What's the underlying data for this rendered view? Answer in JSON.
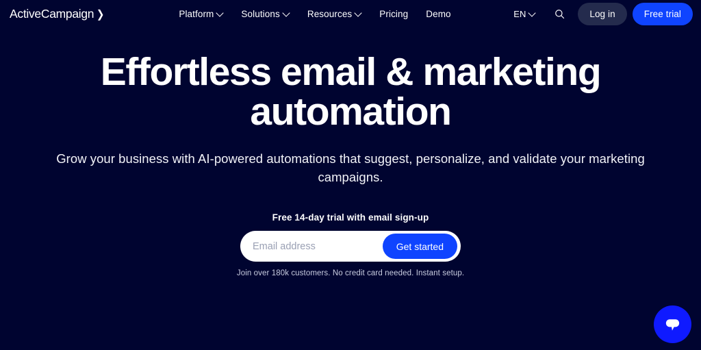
{
  "brand": {
    "name": "ActiveCampaign",
    "arrow_icon": "chevron-right-icon"
  },
  "nav": {
    "items": [
      {
        "label": "Platform",
        "has_dropdown": true
      },
      {
        "label": "Solutions",
        "has_dropdown": true
      },
      {
        "label": "Resources",
        "has_dropdown": true
      },
      {
        "label": "Pricing",
        "has_dropdown": false
      },
      {
        "label": "Demo",
        "has_dropdown": false
      }
    ],
    "language": "EN",
    "search_icon": "search-icon",
    "login_label": "Log in",
    "trial_label": "Free trial"
  },
  "hero": {
    "headline": "Effortless email & marketing automation",
    "subheadline": "Grow your business with AI-powered automations that suggest, personalize, and validate your marketing campaigns."
  },
  "signup": {
    "trial_label": "Free 14-day trial with email sign-up",
    "email_placeholder": "Email address",
    "email_value": "",
    "submit_label": "Get started",
    "fineprint": "Join over 180k customers. No credit card needed. Instant setup."
  },
  "chat": {
    "icon": "chat-bubble-icon"
  },
  "colors": {
    "background": "#000430",
    "accent_blue": "#0f44ff",
    "login_button": "#242b4d",
    "chat_blue": "#0f1aff",
    "text_primary": "#ffffff",
    "fineprint": "#c9cde0"
  }
}
